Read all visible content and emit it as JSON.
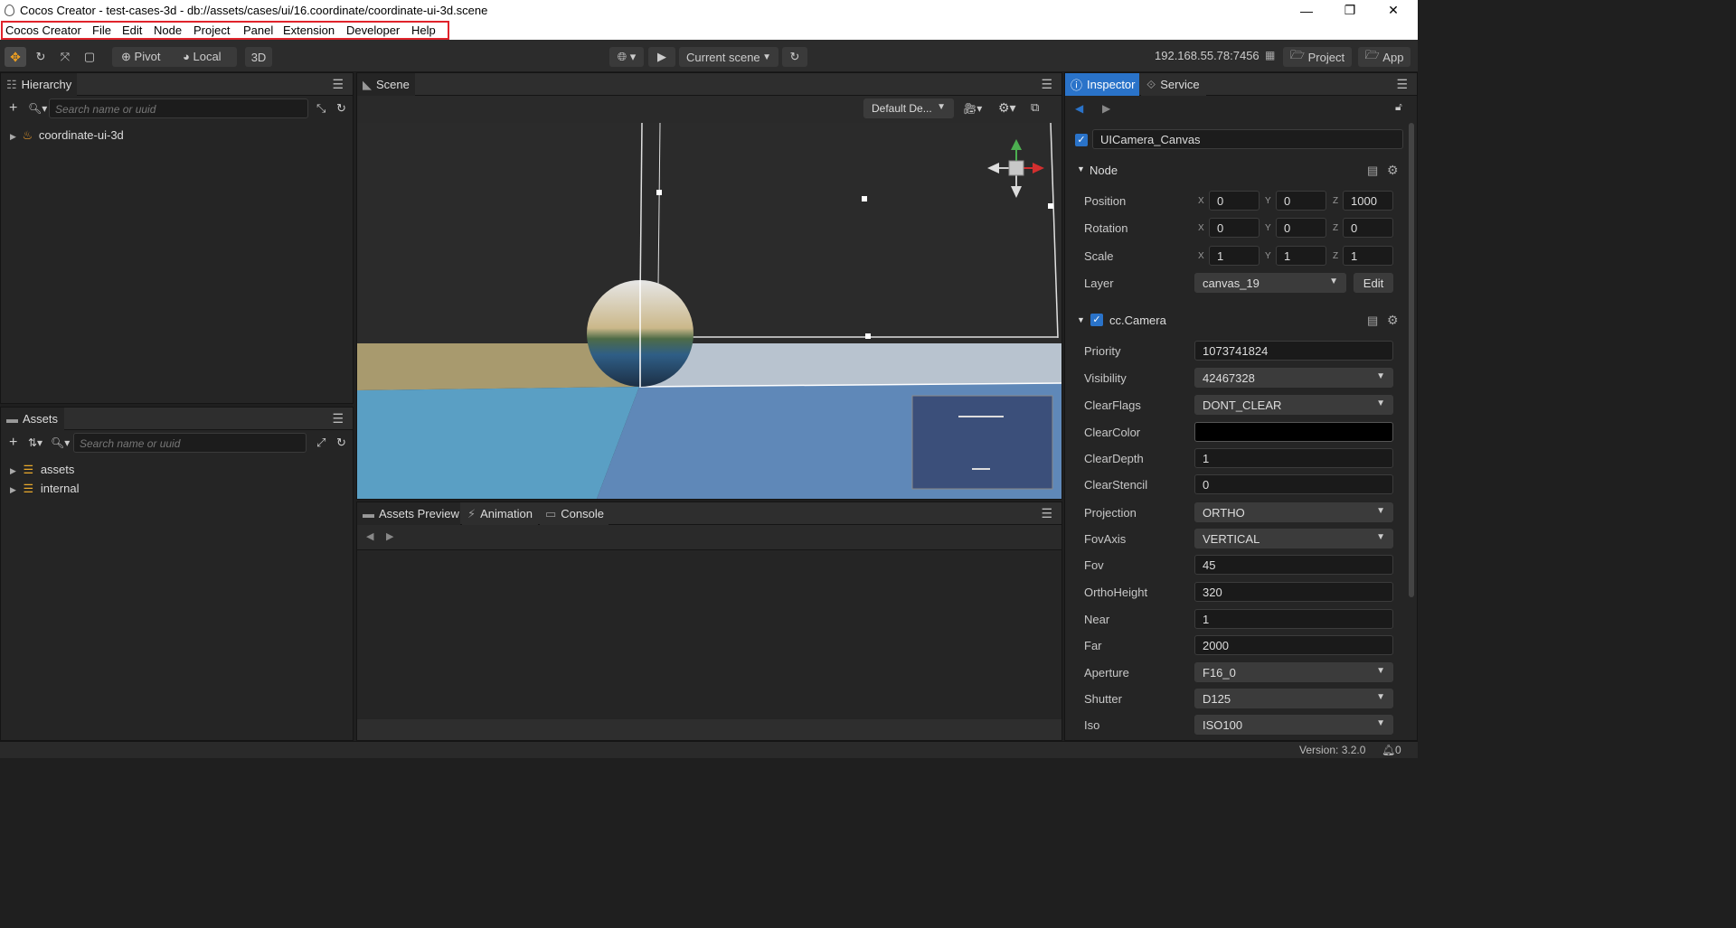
{
  "window": {
    "title": "Cocos Creator - test-cases-3d - db://assets/cases/ui/16.coordinate/coordinate-ui-3d.scene",
    "minimize": "—",
    "maximize": "❐",
    "close": "✕"
  },
  "menu": [
    "Cocos Creator",
    "File",
    "Edit",
    "Node",
    "Project",
    "Panel",
    "Extension",
    "Developer",
    "Help"
  ],
  "toolbar": {
    "pivot": "Pivot",
    "local": "Local",
    "mode3d": "3D",
    "scene_select": "Current scene",
    "ip": "192.168.55.78:7456",
    "project": "Project",
    "app": "App"
  },
  "hierarchy": {
    "tab": "Hierarchy",
    "search_placeholder": "Search name or uuid",
    "root": "coordinate-ui-3d"
  },
  "assets": {
    "tab": "Assets",
    "search_placeholder": "Search name or uuid",
    "items": [
      "assets",
      "internal"
    ]
  },
  "scene": {
    "tab": "Scene",
    "camera_select": "Default De..."
  },
  "bottom": {
    "tabs": [
      "Assets Preview",
      "Animation",
      "Console"
    ]
  },
  "inspector": {
    "tabs": [
      "Inspector",
      "Service"
    ],
    "node_name": "UICamera_Canvas",
    "node_section": "Node",
    "position": {
      "label": "Position",
      "x": "0",
      "y": "0",
      "z": "1000"
    },
    "rotation": {
      "label": "Rotation",
      "x": "0",
      "y": "0",
      "z": "0"
    },
    "scale": {
      "label": "Scale",
      "x": "1",
      "y": "1",
      "z": "1"
    },
    "layer": {
      "label": "Layer",
      "value": "canvas_19",
      "edit": "Edit"
    },
    "axis_labels": {
      "x": "X",
      "y": "Y",
      "z": "Z"
    },
    "camera_section": "cc.Camera",
    "camera_props": [
      {
        "label": "Priority",
        "value": "1073741824",
        "type": "input"
      },
      {
        "label": "Visibility",
        "value": "42467328",
        "type": "select"
      },
      {
        "label": "ClearFlags",
        "value": "DONT_CLEAR",
        "type": "select"
      },
      {
        "label": "ClearColor",
        "value": "",
        "type": "color"
      },
      {
        "label": "ClearDepth",
        "value": "1",
        "type": "input"
      },
      {
        "label": "ClearStencil",
        "value": "0",
        "type": "input"
      },
      {
        "label": "Projection",
        "value": "ORTHO",
        "type": "select"
      },
      {
        "label": "FovAxis",
        "value": "VERTICAL",
        "type": "select"
      },
      {
        "label": "Fov",
        "value": "45",
        "type": "input"
      },
      {
        "label": "OrthoHeight",
        "value": "320",
        "type": "input"
      },
      {
        "label": "Near",
        "value": "1",
        "type": "input"
      },
      {
        "label": "Far",
        "value": "2000",
        "type": "input"
      },
      {
        "label": "Aperture",
        "value": "F16_0",
        "type": "select"
      },
      {
        "label": "Shutter",
        "value": "D125",
        "type": "select"
      },
      {
        "label": "Iso",
        "value": "ISO100",
        "type": "select"
      }
    ]
  },
  "status": {
    "version": "Version: 3.2.0",
    "notifications": "0"
  },
  "colors": {
    "accent": "#2a73c9",
    "menu_highlight": "#e0232b",
    "clear_color": "#000000"
  }
}
